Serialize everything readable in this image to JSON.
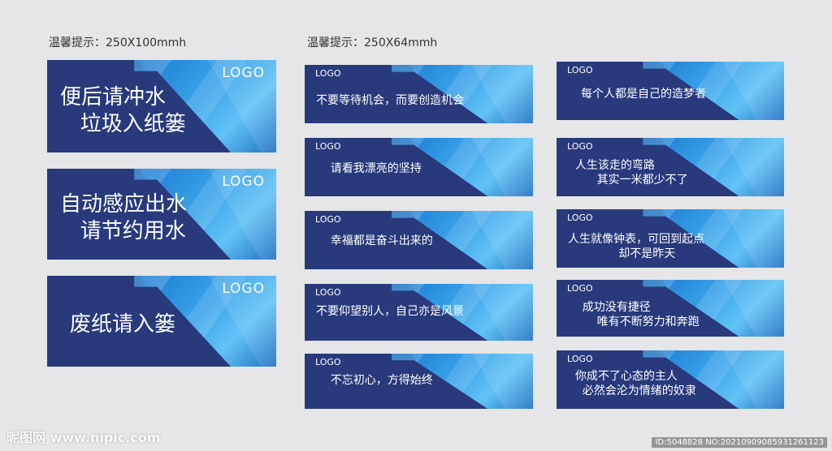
{
  "headers": {
    "left": "温馨提示：250X100mmh",
    "right": "温馨提示：250X64mmh"
  },
  "logo_label": "LOGO",
  "big_signs": [
    {
      "text": "便后请冲水\n   垃圾入纸篓"
    },
    {
      "text": "自动感应出水\n   请节约用水"
    },
    {
      "text": "废纸请入篓"
    }
  ],
  "small_signs_col1": [
    {
      "text": "不要等待机会，而要创造机会"
    },
    {
      "text": "    请看我漂亮的坚持"
    },
    {
      "text": "    幸福都是奋斗出来的"
    },
    {
      "text": "不要仰望别人，自己亦是风景"
    },
    {
      "text": "    不忘初心，方得始终"
    }
  ],
  "small_signs_col2": [
    {
      "text": "每个人都是自己的造梦者"
    },
    {
      "text": "  人生该走的弯路\n        其实一米都少不了"
    },
    {
      "text": "人生就像钟表，可回到起点\n              却不是昨天"
    },
    {
      "text": "    成功没有捷径\n        唯有不断努力和奔跑"
    },
    {
      "text": "  你成不了心态的主人\n    必然会沦为情绪的奴隶"
    }
  ],
  "watermark": {
    "left": "昵图网 www.nipic.com",
    "right": "ID:5048828 NO:20210909085931261123"
  },
  "colors": {
    "navy": "#283a7c",
    "blue": "#3aa4ea",
    "background": "#e6e6e8"
  }
}
